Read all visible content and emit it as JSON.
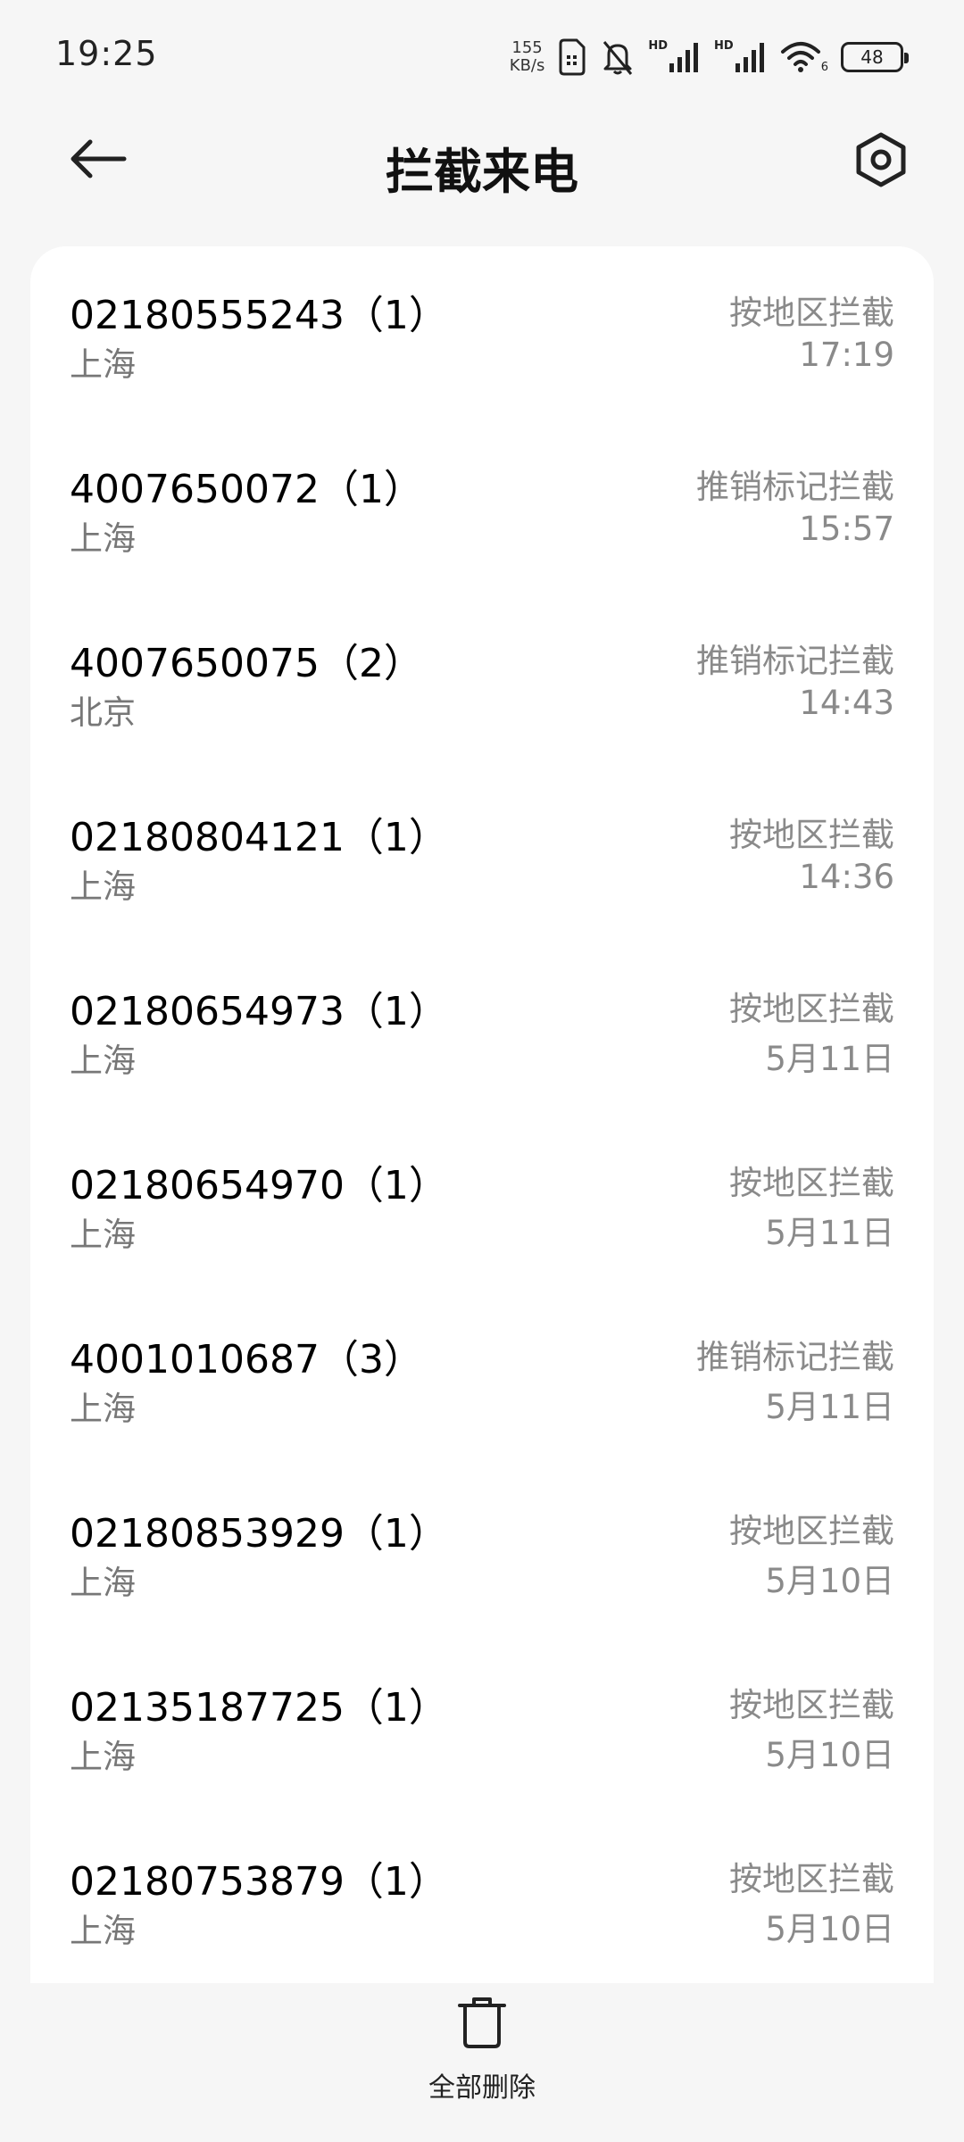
{
  "status_bar": {
    "time": "19:25",
    "net_speed_value": "155",
    "net_speed_unit": "KB/s",
    "signal_label_1": "HD",
    "signal_label_2": "HD",
    "wifi_level": "6",
    "battery_level": "48"
  },
  "header": {
    "title": "拦截来电",
    "back_icon": "arrow-left-icon",
    "settings_icon": "gear-icon"
  },
  "calls": [
    {
      "number": "02180555243（1）",
      "location": "上海",
      "reason": "按地区拦截",
      "time": "17:19"
    },
    {
      "number": "4007650072（1）",
      "location": "上海",
      "reason": "推销标记拦截",
      "time": "15:57"
    },
    {
      "number": "4007650075（2）",
      "location": "北京",
      "reason": "推销标记拦截",
      "time": "14:43"
    },
    {
      "number": "02180804121（1）",
      "location": "上海",
      "reason": "按地区拦截",
      "time": "14:36"
    },
    {
      "number": "02180654973（1）",
      "location": "上海",
      "reason": "按地区拦截",
      "time": "5月11日"
    },
    {
      "number": "02180654970（1）",
      "location": "上海",
      "reason": "按地区拦截",
      "time": "5月11日"
    },
    {
      "number": "4001010687（3）",
      "location": "上海",
      "reason": "推销标记拦截",
      "time": "5月11日"
    },
    {
      "number": "02180853929（1）",
      "location": "上海",
      "reason": "按地区拦截",
      "time": "5月10日"
    },
    {
      "number": "02135187725（1）",
      "location": "上海",
      "reason": "按地区拦截",
      "time": "5月10日"
    },
    {
      "number": "02180753879（1）",
      "location": "上海",
      "reason": "按地区拦截",
      "time": "5月10日"
    }
  ],
  "bottom_bar": {
    "delete_all_label": "全部删除",
    "delete_icon": "trash-icon"
  }
}
